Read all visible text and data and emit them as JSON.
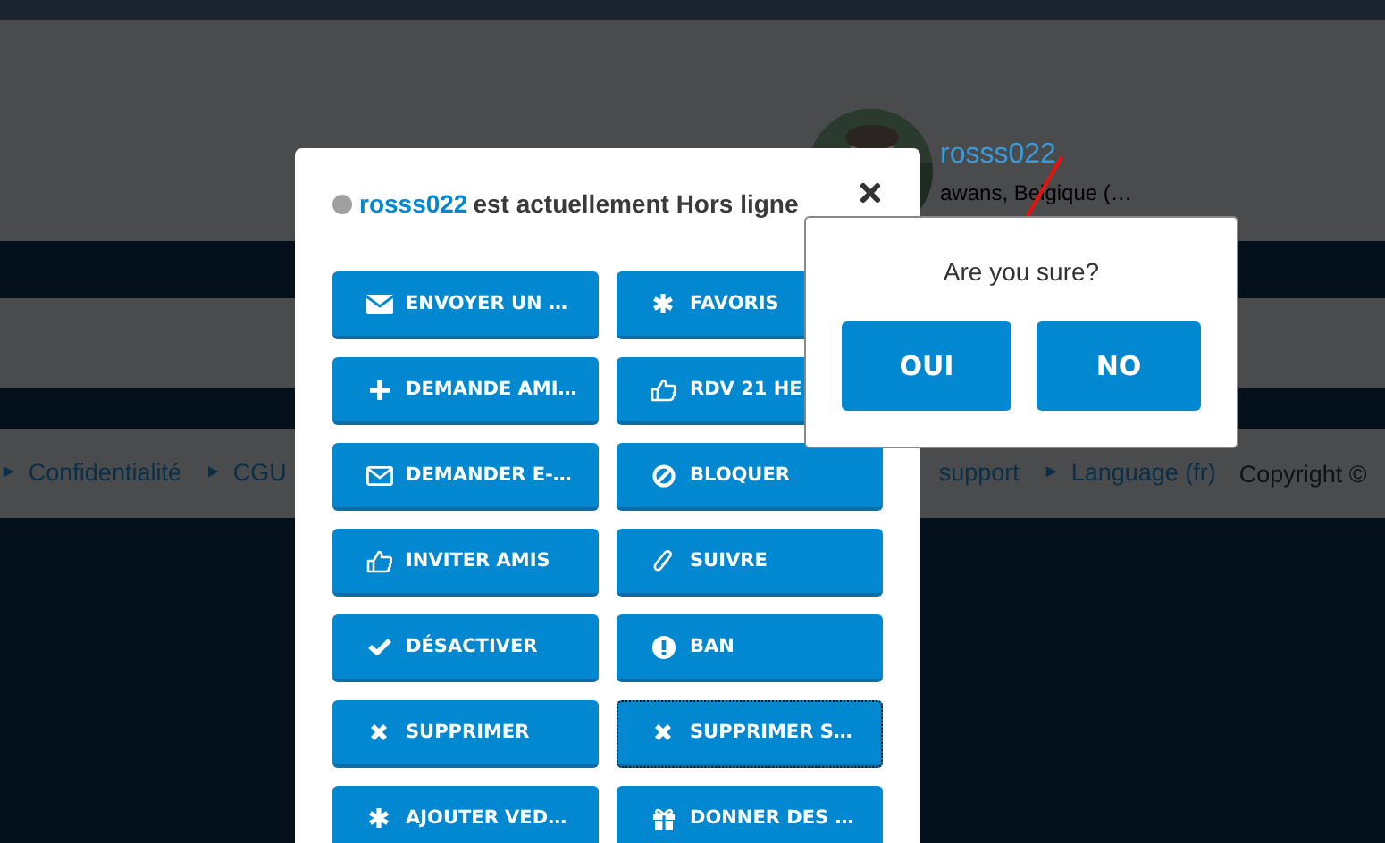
{
  "page": {
    "profile": {
      "username": "rosss022",
      "location": "awans, Belgique (…"
    },
    "footer_links": [
      {
        "bullet": "►",
        "label": "Confidentialité"
      },
      {
        "bullet": "►",
        "label": "CGU"
      },
      {
        "label": "support"
      },
      {
        "bullet": "►",
        "label": "Language (fr)"
      }
    ],
    "copyright": "Copyright ©"
  },
  "modal": {
    "username": "rosss022",
    "status_text": "est actuellement Hors ligne",
    "online": false,
    "buttons": [
      {
        "label": "ENVOYER UN …",
        "focused": false
      },
      {
        "label": "FAVORIS",
        "focused": false
      },
      {
        "label": "DEMANDE AMI…",
        "focused": false
      },
      {
        "label": "RDV 21 HE",
        "focused": false
      },
      {
        "label": "DEMANDER E-…",
        "focused": false
      },
      {
        "label": "BLOQUER",
        "focused": false
      },
      {
        "label": "INVITER AMIS",
        "focused": false
      },
      {
        "label": "SUIVRE",
        "focused": false
      },
      {
        "label": "DÉSACTIVER",
        "focused": false
      },
      {
        "label": "BAN",
        "focused": false
      },
      {
        "label": "SUPPRIMER",
        "focused": false
      },
      {
        "label": "SUPPRIMER S…",
        "focused": true
      },
      {
        "label": "AJOUTER VED…",
        "focused": false
      },
      {
        "label": "DONNER DES …",
        "focused": false
      }
    ]
  },
  "confirm": {
    "question": "Are you sure?",
    "buttons": [
      "OUI",
      "NO"
    ]
  }
}
